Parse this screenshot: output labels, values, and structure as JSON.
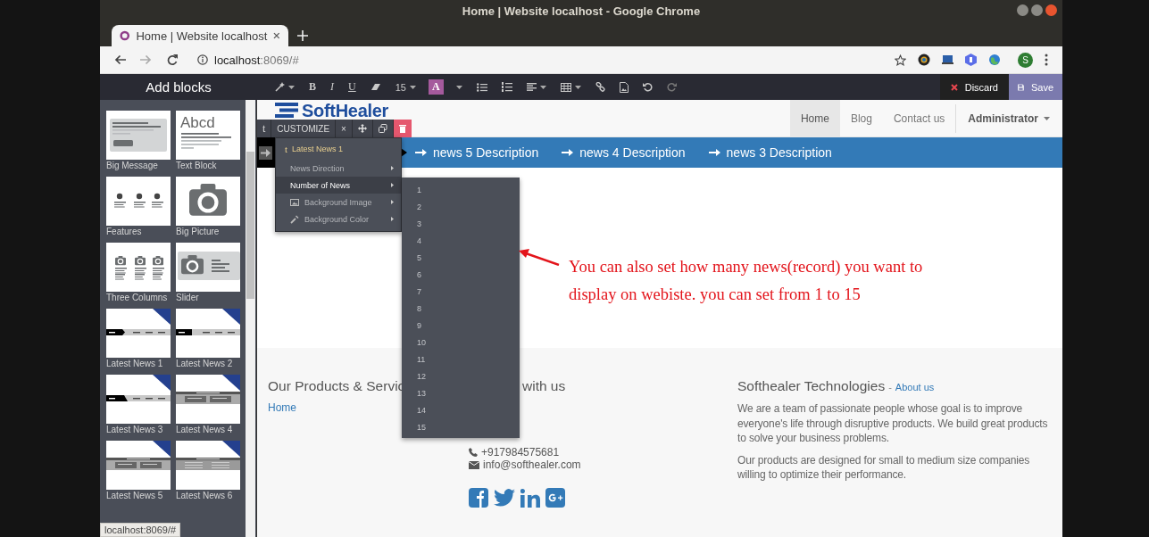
{
  "window": {
    "title": "Home | Website localhost - Google Chrome"
  },
  "browser_tabs": [
    {
      "label": "Home | Website localhost",
      "selected": true
    }
  ],
  "address_bar": {
    "host": "localhost",
    "path": ":8069/#"
  },
  "profile": {
    "initial": "S"
  },
  "editor_toolbar": {
    "title": "Add blocks",
    "tools": [
      {
        "kind": "wand",
        "dropdown": true
      },
      {
        "kind": "text",
        "label": "B",
        "dropdown": false
      },
      {
        "kind": "text",
        "label": "I",
        "dropdown": false
      },
      {
        "kind": "text",
        "label": "U",
        "dropdown": false
      },
      {
        "kind": "eraser",
        "dropdown": false
      },
      {
        "kind": "text",
        "label": "15",
        "dropdown": true
      },
      {
        "kind": "swatch",
        "label": "A",
        "dropdown": false
      },
      {
        "kind": "caret",
        "dropdown": true
      },
      {
        "kind": "ul",
        "dropdown": false
      },
      {
        "kind": "ol",
        "dropdown": false
      },
      {
        "kind": "align",
        "dropdown": true
      },
      {
        "kind": "table",
        "dropdown": true
      },
      {
        "kind": "link",
        "dropdown": false
      },
      {
        "kind": "image",
        "dropdown": false
      },
      {
        "kind": "undo",
        "dropdown": false
      },
      {
        "kind": "redo",
        "dropdown": false
      }
    ],
    "discard": "Discard",
    "save": "Save"
  },
  "blocks": [
    {
      "label": "Big Message",
      "kind": "message"
    },
    {
      "label": "Text Block",
      "kind": "text",
      "sample": "Abcd"
    },
    {
      "label": "Features",
      "kind": "features"
    },
    {
      "label": "Big Picture",
      "kind": "picture"
    },
    {
      "label": "Three Columns",
      "kind": "columns"
    },
    {
      "label": "Slider",
      "kind": "slider"
    },
    {
      "label": "Latest News 1",
      "kind": "news-arrow"
    },
    {
      "label": "Latest News 2",
      "kind": "news-plain"
    },
    {
      "label": "Latest News 3",
      "kind": "news-angle"
    },
    {
      "label": "Latest News 4",
      "kind": "news-cards"
    },
    {
      "label": "Latest News 5",
      "kind": "news-cards"
    },
    {
      "label": "Latest News 6",
      "kind": "news-lines"
    }
  ],
  "site_nav": {
    "logo": "SoftHealer",
    "items": [
      {
        "label": "Home",
        "selected": true
      },
      {
        "label": "Blog",
        "selected": false
      },
      {
        "label": "Contact us",
        "selected": false
      }
    ],
    "user": "Administrator"
  },
  "ticker": {
    "items": [
      "news 5 Description",
      "news 4 Description",
      "news 3 Description"
    ]
  },
  "customize_bar": {
    "tag": "t",
    "label": "CUSTOMIZE",
    "close": "×"
  },
  "customize_menu": {
    "header_icon": "t",
    "header": "Latest News 1",
    "items": [
      {
        "label": "News Direction",
        "kind": "plain",
        "selected": false
      },
      {
        "label": "Number of News",
        "kind": "plain",
        "selected": true
      },
      {
        "label": "Background Image",
        "kind": "image",
        "selected": false
      },
      {
        "label": "Background Color",
        "kind": "color",
        "selected": false
      }
    ]
  },
  "number_submenu": {
    "options": [
      "1",
      "2",
      "3",
      "4",
      "5",
      "6",
      "7",
      "8",
      "9",
      "10",
      "11",
      "12",
      "13",
      "14",
      "15"
    ]
  },
  "annotation": {
    "text": "You can also set how many news(record) you want to display on webiste. you can set from 1 to 15"
  },
  "footer": {
    "columns": [
      {
        "heading": "Our Products & Servic",
        "links": [
          "Home"
        ]
      },
      {
        "heading": "with us",
        "phone": "+917984575681",
        "email": "info@softhealer.com",
        "socials": [
          {
            "kind": "facebook"
          },
          {
            "kind": "twitter"
          },
          {
            "kind": "linkedin"
          },
          {
            "kind": "google"
          }
        ]
      },
      {
        "heading": "Softhealer Technologies",
        "heading_separator": "-",
        "heading_link": "About us",
        "paragraphs": [
          "We are a team of passionate people whose goal is to improve everyone's life through disruptive products. We build great products to solve your business problems.",
          "Our products are designed for small to medium size companies willing to optimize their performance."
        ]
      }
    ]
  },
  "status_bubble": "localhost:8069/#"
}
